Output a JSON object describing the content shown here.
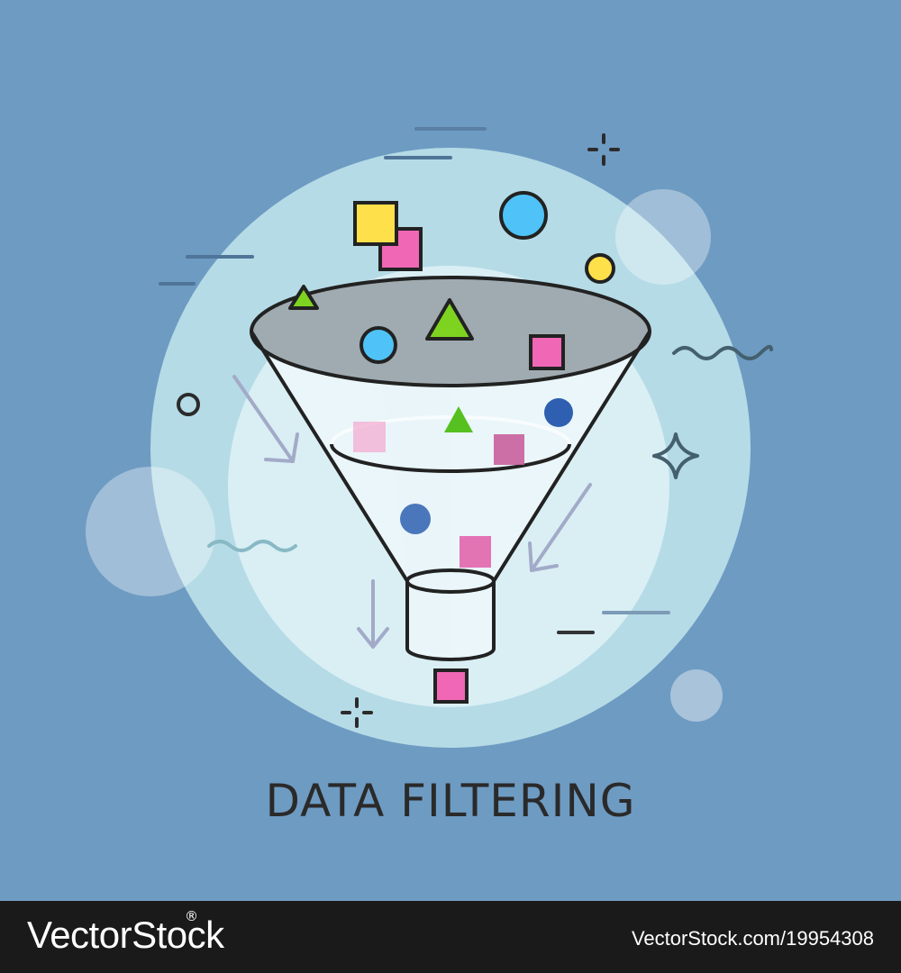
{
  "caption": "DATA FILTERING",
  "watermark": {
    "brand": "VectorStock",
    "registered_mark": "®",
    "image_id": "VectorStock.com/19954308"
  },
  "colors": {
    "background": "#6e9bc2",
    "circle_outer": "#b5dbe6",
    "circle_inner": "#d9eff4",
    "funnel_top": "#9fabb0",
    "yellow": "#fde04a",
    "pink": "#f067b6",
    "cyan": "#4fc3f7",
    "green": "#7ed321",
    "blue": "#2e5fb0",
    "outline": "#222222"
  },
  "icons": [
    "funnel-icon",
    "square-shape",
    "circle-shape",
    "triangle-shape",
    "arrow-icon",
    "sparkle-icon",
    "wave-icon"
  ]
}
